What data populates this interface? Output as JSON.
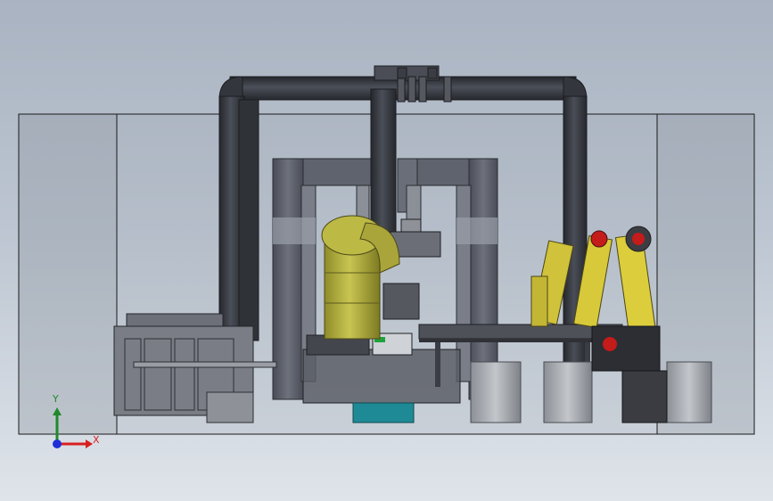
{
  "viewport": {
    "background_top": "#a9b3c1",
    "background_bottom": "#dfe4ea"
  },
  "triad": {
    "x_label": "X",
    "y_label": "Y",
    "x_color": "#d81f1f",
    "y_color": "#1f8a2a",
    "z_color": "#1f2fd8"
  },
  "colors": {
    "duct": "#3a3d44",
    "frame": "#5d616c",
    "silo": "#b7b33c",
    "robot": "#d8c93a",
    "robot_joint": "#c41b1b",
    "base": "#1e8a96",
    "enclosure_edge": "#1a1a1a"
  },
  "components": [
    "enclosure",
    "exhaust-duct",
    "gantry-frame",
    "mixing-silo",
    "robot-arm",
    "conveyor",
    "barrel",
    "machine-housing"
  ]
}
